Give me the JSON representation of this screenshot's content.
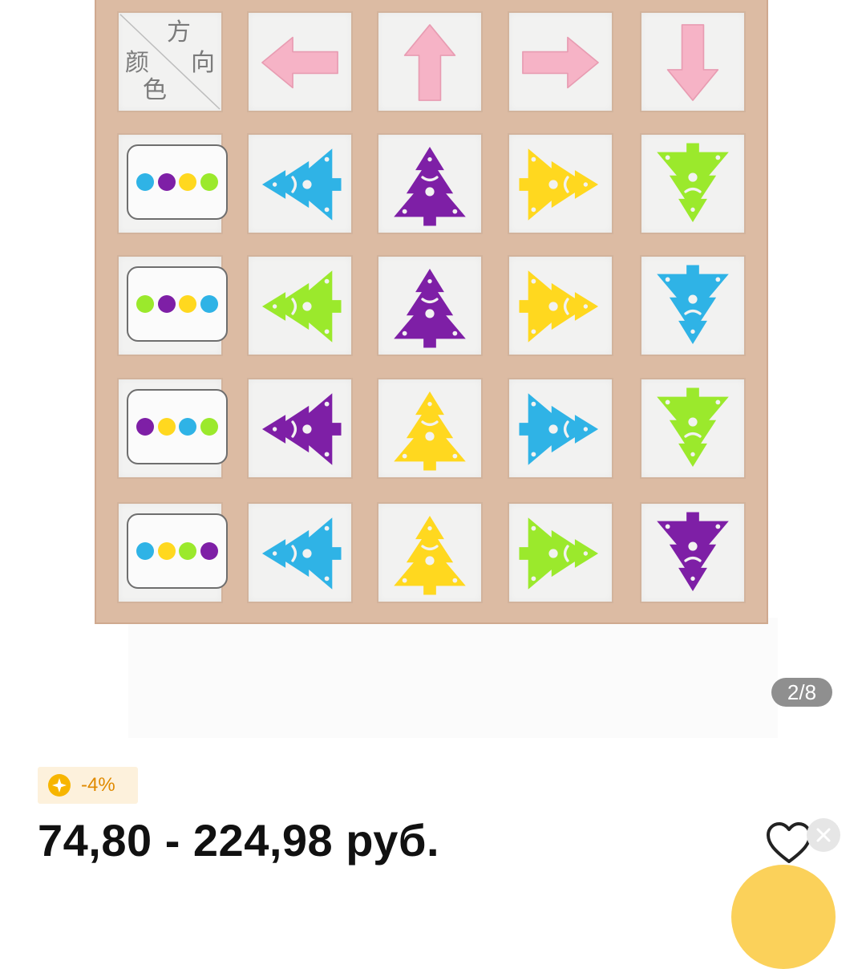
{
  "gallery": {
    "counter": "2/8",
    "board": {
      "header": {
        "corner_chars": [
          "方",
          "向",
          "颜",
          "色"
        ],
        "arrows": [
          "left",
          "up",
          "right",
          "down"
        ],
        "arrow_color": "#f6b3c6"
      },
      "colors": {
        "blue": "#2fb3e6",
        "purple": "#7e1fa6",
        "yellow": "#ffd81f",
        "green": "#9be92c"
      },
      "rows": [
        {
          "dots": [
            "blue",
            "purple",
            "yellow",
            "green"
          ],
          "pieces": [
            {
              "color": "blue",
              "dir": "left"
            },
            {
              "color": "purple",
              "dir": "up"
            },
            {
              "color": "yellow",
              "dir": "right"
            },
            {
              "color": "green",
              "dir": "down"
            }
          ]
        },
        {
          "dots": [
            "green",
            "purple",
            "yellow",
            "blue"
          ],
          "pieces": [
            {
              "color": "green",
              "dir": "left"
            },
            {
              "color": "purple",
              "dir": "up"
            },
            {
              "color": "yellow",
              "dir": "right"
            },
            {
              "color": "blue",
              "dir": "down"
            }
          ]
        },
        {
          "dots": [
            "purple",
            "yellow",
            "blue",
            "green"
          ],
          "pieces": [
            {
              "color": "purple",
              "dir": "left"
            },
            {
              "color": "yellow",
              "dir": "up"
            },
            {
              "color": "blue",
              "dir": "right"
            },
            {
              "color": "green",
              "dir": "down"
            }
          ]
        },
        {
          "dots": [
            "blue",
            "yellow",
            "green",
            "purple"
          ],
          "pieces": [
            {
              "color": "blue",
              "dir": "left"
            },
            {
              "color": "yellow",
              "dir": "up"
            },
            {
              "color": "green",
              "dir": "right"
            },
            {
              "color": "purple",
              "dir": "down"
            }
          ]
        }
      ]
    }
  },
  "discount": {
    "icon": "coin-star-icon",
    "text": "-4%",
    "color": "#e08a00"
  },
  "price": {
    "text": "74,80 - 224,98 руб."
  },
  "actions": {
    "favorite_icon": "heart-outline-icon",
    "close_icon": "close-icon"
  }
}
